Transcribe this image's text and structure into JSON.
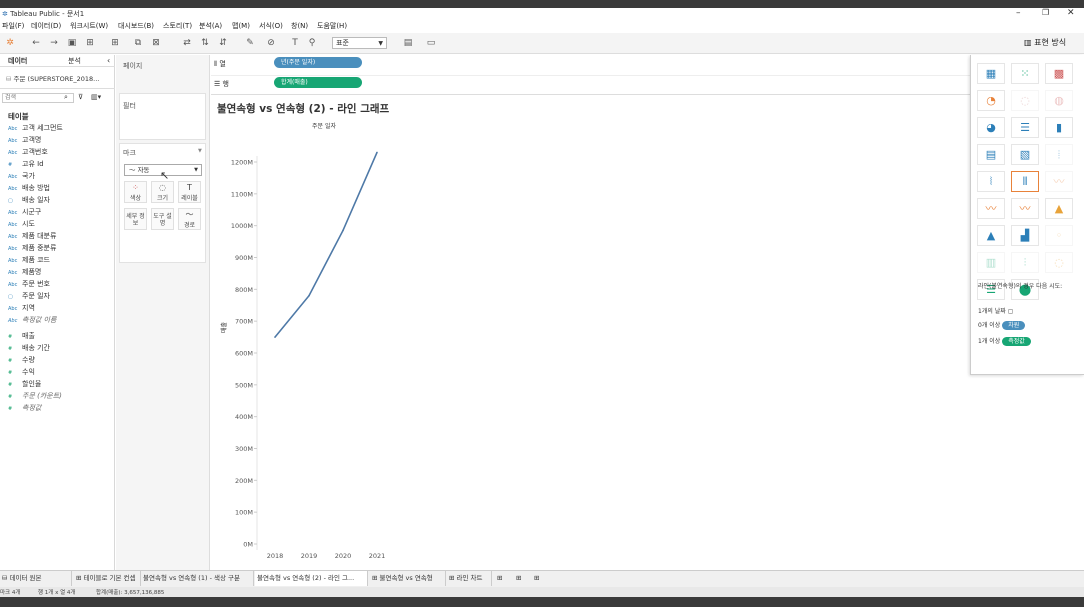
{
  "app": {
    "title": "Tableau Public - 문서1"
  },
  "menu": [
    "파일(F)",
    "데이터(D)",
    "워크시트(W)",
    "대시보드(B)",
    "스토리(T)",
    "분석(A)",
    "맵(M)",
    "서식(O)",
    "창(N)",
    "도움말(H)"
  ],
  "toolbar": {
    "format_select": "표준",
    "show_me_label": "표현 방식"
  },
  "datapane": {
    "tab_data": "데이터",
    "tab_analysis": "분석",
    "source": "주문 (SUPERSTORE_2018...",
    "search_placeholder": "검색",
    "section": "테이블",
    "dimensions": [
      {
        "type": "Abc",
        "name": "고객 세그먼트"
      },
      {
        "type": "Abc",
        "name": "고객명"
      },
      {
        "type": "Abc",
        "name": "고객번호"
      },
      {
        "type": "#",
        "name": "고유 Id"
      },
      {
        "type": "Abc",
        "name": "국가"
      },
      {
        "type": "Abc",
        "name": "배송 방법"
      },
      {
        "type": "date",
        "name": "배송 일자"
      },
      {
        "type": "Abc",
        "name": "시군구"
      },
      {
        "type": "Abc",
        "name": "시도"
      },
      {
        "type": "Abc",
        "name": "제품 대분류"
      },
      {
        "type": "Abc",
        "name": "제품 중분류"
      },
      {
        "type": "Abc",
        "name": "제품 코드"
      },
      {
        "type": "Abc",
        "name": "제품명"
      },
      {
        "type": "Abc",
        "name": "주문 번호"
      },
      {
        "type": "date",
        "name": "주문 일자"
      },
      {
        "type": "Abc",
        "name": "지역"
      },
      {
        "type": "Abc",
        "name": "측정값 이름"
      }
    ],
    "measures": [
      {
        "type": "#",
        "name": "매출"
      },
      {
        "type": "#",
        "name": "배송 기간"
      },
      {
        "type": "#",
        "name": "수량"
      },
      {
        "type": "#",
        "name": "수익"
      },
      {
        "type": "#",
        "name": "할인율"
      },
      {
        "type": "#",
        "name": "주문 (카운트)"
      },
      {
        "type": "#",
        "name": "측정값"
      }
    ]
  },
  "cards": {
    "pages": "페이지",
    "filters": "필터",
    "marks": "마크",
    "mark_type": "자동",
    "buttons": {
      "color": "색상",
      "size": "크기",
      "label": "레이블",
      "detail": "세부 정보",
      "tooltip": "도구 설명",
      "path": "경로"
    }
  },
  "shelves": {
    "columns_label": "열",
    "rows_label": "행",
    "columns_pill": "년(주문 일자)",
    "rows_pill": "합계(매출)",
    "pill_blue": "#4a8fbd",
    "pill_green": "#17a674"
  },
  "viz": {
    "title": "불연속형 vs 연속형 (2) - 라인 그래프",
    "header": "주문 일자",
    "ylabel": "매출"
  },
  "chart_data": {
    "type": "line",
    "title": "불연속형 vs 연속형 (2) - 라인 그래프",
    "xlabel": "주문 일자",
    "ylabel": "매출",
    "categories": [
      "2018",
      "2019",
      "2020",
      "2021"
    ],
    "series": [
      {
        "values": [
          650,
          780,
          985,
          1230
        ]
      }
    ],
    "ylim": [
      0,
      1300
    ],
    "yticks": [
      0,
      100,
      200,
      300,
      400,
      500,
      600,
      700,
      800,
      900,
      1000,
      1100,
      1200
    ],
    "ytick_labels": [
      "0M",
      "100M",
      "200M",
      "300M",
      "400M",
      "500M",
      "600M",
      "700M",
      "800M",
      "900M",
      "1000M",
      "1100M",
      "1200M"
    ],
    "line_color": "#4e79a7",
    "grid": false
  },
  "showme": {
    "hint": "라인(불연속형)의 경우 다음 시도:",
    "req1": "1개의 날짜",
    "req2_prefix": "0개 이상",
    "req2_pill": "차원",
    "req3_prefix": "1개 이상",
    "req3_pill": "측정값"
  },
  "sheet_tabs": [
    "데이터 원본",
    "테이블로 기본 컨셉",
    "불연속형 vs 연속형 (1) - 색상 구분",
    "불연속형 vs 연속형 (2) - 라인 그...",
    "불연속형 vs 연속형",
    "라인 차트"
  ],
  "status": {
    "marks": "마크 4개",
    "rows_cols": "행 1개 x 열 4개",
    "sum": "합계(매출): 3,657,136,885"
  }
}
